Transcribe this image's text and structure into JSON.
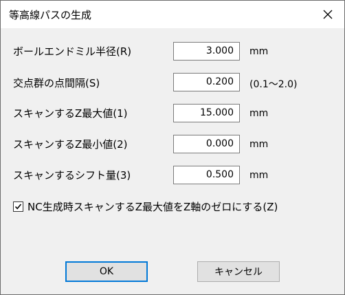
{
  "window": {
    "title": "等高線パスの生成"
  },
  "fields": [
    {
      "label": "ボールエンドミル半径(R)",
      "value": "3.000",
      "unit": "mm"
    },
    {
      "label": "交点群の点間隔(S)",
      "value": "0.200",
      "unit": "(0.1～2.0)"
    },
    {
      "label": "スキャンするZ最大値(1)",
      "value": "15.000",
      "unit": "mm"
    },
    {
      "label": "スキャンするZ最小値(2)",
      "value": "0.000",
      "unit": "mm"
    },
    {
      "label": "スキャンするシフト量(3)",
      "value": "0.500",
      "unit": "mm"
    }
  ],
  "checkbox": {
    "label": "NC生成時スキャンするZ最大値をZ軸のゼロにする(Z)",
    "checked": true
  },
  "buttons": {
    "ok": "OK",
    "cancel": "キャンセル"
  }
}
